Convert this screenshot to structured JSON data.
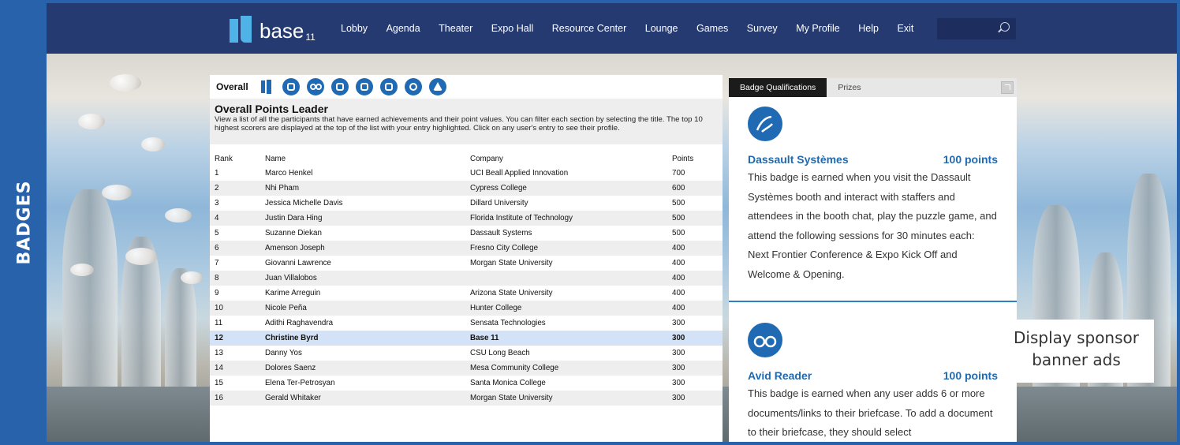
{
  "side_label": "BADGES",
  "nav": {
    "logo_text": "base",
    "logo_sub": "11",
    "items": [
      "Lobby",
      "Agenda",
      "Theater",
      "Expo Hall",
      "Resource Center",
      "Lounge",
      "Games",
      "Survey",
      "My Profile",
      "Help",
      "Exit"
    ],
    "search_placeholder": ""
  },
  "leaderboard": {
    "tab_overall": "Overall",
    "badge_icons": [
      "base11-logo-icon",
      "dassault-systemes-icon",
      "avid-reader-icon",
      "document-icon",
      "chat-icon",
      "message-icon",
      "handshake-icon",
      "pyramid-icon"
    ],
    "title": "Overall Points Leader",
    "description": "View a list of all the participants that have earned achievements and their point values. You can filter each section by selecting the title. The top 10 highest scorers are displayed at the top of the list with your entry highlighted. Click on any user's entry to see their profile.",
    "columns": [
      "Rank",
      "Name",
      "Company",
      "Points"
    ],
    "rows": [
      {
        "rank": "1",
        "name": "Marco Henkel",
        "company": "UCI Beall Applied Innovation",
        "points": "700"
      },
      {
        "rank": "2",
        "name": "Nhi Pham",
        "company": "Cypress College",
        "points": "600"
      },
      {
        "rank": "3",
        "name": "Jessica Michelle Davis",
        "company": "Dillard University",
        "points": "500"
      },
      {
        "rank": "4",
        "name": "Justin Dara Hing",
        "company": "Florida Institute of Technology",
        "points": "500"
      },
      {
        "rank": "5",
        "name": "Suzanne Diekan",
        "company": "Dassault Systems",
        "points": "500"
      },
      {
        "rank": "6",
        "name": "Amenson Joseph",
        "company": "Fresno City College",
        "points": "400"
      },
      {
        "rank": "7",
        "name": "Giovanni Lawrence",
        "company": "Morgan State University",
        "points": "400"
      },
      {
        "rank": "8",
        "name": "Juan Villalobos",
        "company": "",
        "points": "400"
      },
      {
        "rank": "9",
        "name": "Karime Arreguin",
        "company": "Arizona State University",
        "points": "400"
      },
      {
        "rank": "10",
        "name": "Nicole Peña",
        "company": "Hunter College",
        "points": "400"
      },
      {
        "rank": "11",
        "name": "Adithi Raghavendra",
        "company": "Sensata Technologies",
        "points": "300"
      },
      {
        "rank": "12",
        "name": "Christine Byrd",
        "company": "Base 11",
        "points": "300",
        "highlighted": true
      },
      {
        "rank": "13",
        "name": "Danny Yos",
        "company": "CSU Long Beach",
        "points": "300"
      },
      {
        "rank": "14",
        "name": "Dolores Saenz",
        "company": "Mesa Community College",
        "points": "300"
      },
      {
        "rank": "15",
        "name": "Elena Ter-Petrosyan",
        "company": "Santa Monica College",
        "points": "300"
      },
      {
        "rank": "16",
        "name": "Gerald Whitaker",
        "company": "Morgan State University",
        "points": "300"
      }
    ]
  },
  "badges_panel": {
    "tabs": [
      "Badge Qualifications",
      "Prizes"
    ],
    "cards": [
      {
        "icon": "dassault-systemes-icon",
        "name": "Dassault Systèmes",
        "points": "100 points",
        "description": "This badge is earned when you visit the Dassault Systèmes booth and interact with staffers and attendees in the booth chat, play the puzzle game, and attend the following sessions for 30 minutes each: Next Frontier Conference & Expo Kick Off and Welcome & Opening."
      },
      {
        "icon": "avid-reader-icon",
        "name": "Avid Reader",
        "points": "100 points",
        "description": "This badge is earned when any user adds 6 or more documents/links to their briefcase. To add a document to their briefcase, they should select"
      }
    ]
  },
  "callout": {
    "line1": "Display sponsor",
    "line2": "banner ads"
  },
  "colors": {
    "frame_blue": "#2862ab",
    "nav_bg": "#253a70",
    "accent_blue": "#1f6ab3",
    "highlight_row": "#d3e2f6"
  }
}
